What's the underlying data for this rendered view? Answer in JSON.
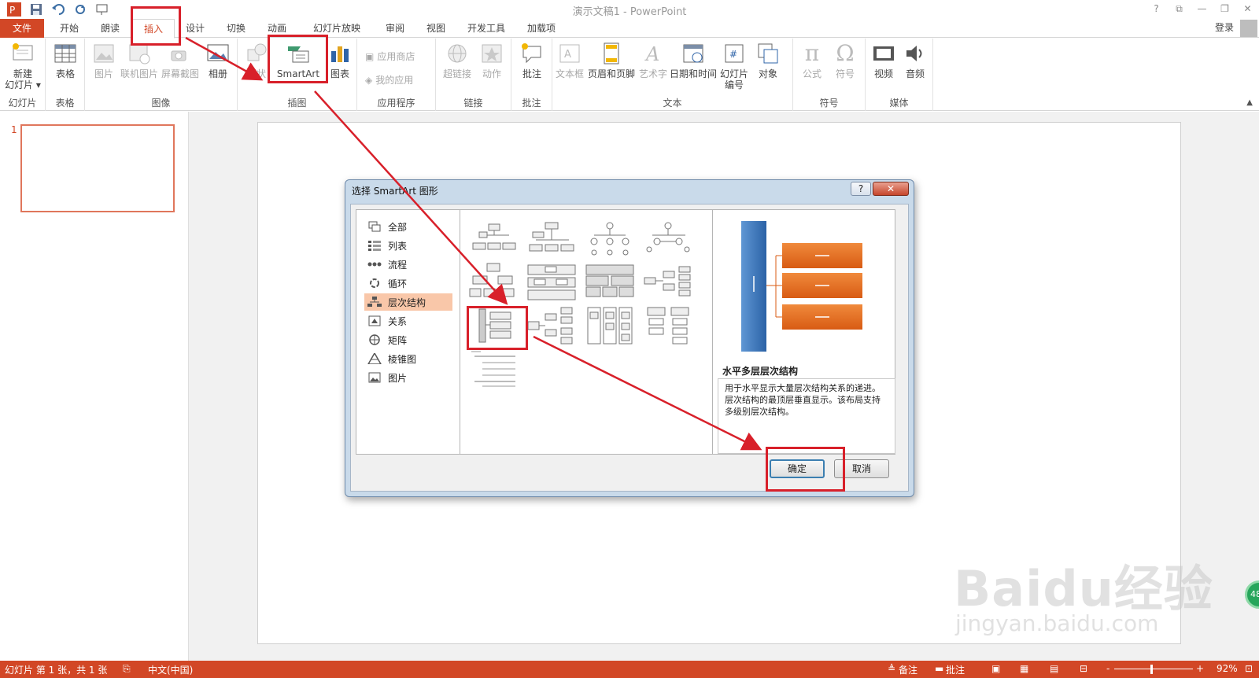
{
  "app": {
    "title": "演示文稿1 - PowerPoint",
    "login": "登录"
  },
  "window": {
    "help": "?",
    "ribbon_display": "⧉",
    "minimize": "—",
    "restore": "❐",
    "close": "✕"
  },
  "tabs": [
    "文件",
    "开始",
    "朗读",
    "插入",
    "设计",
    "切换",
    "动画",
    "幻灯片放映",
    "审阅",
    "视图",
    "开发工具",
    "加载项"
  ],
  "ribbon": {
    "groups": [
      "幻灯片",
      "表格",
      "图像",
      "插图",
      "应用程序",
      "链接",
      "批注",
      "文本",
      "符号",
      "媒体"
    ],
    "new_slide_l1": "新建",
    "new_slide_l2": "幻灯片 ▾",
    "table": "表格",
    "picture": "图片",
    "online_picture": "联机图片",
    "screenshot": "屏幕截图",
    "album": "相册",
    "shapes": "形状",
    "smartart": "SmartArt",
    "chart": "图表",
    "store": "应用商店",
    "my_apps": "我的应用",
    "hyperlink": "超链接",
    "action": "动作",
    "comment": "批注",
    "textbox": "文本框",
    "header_footer": "页眉和页脚",
    "wordart": "艺术字",
    "datetime": "日期和时间",
    "slide_number_l1": "幻灯片",
    "slide_number_l2": "编号",
    "object": "对象",
    "equation": "公式",
    "symbol": "符号",
    "video": "视频",
    "audio": "音频"
  },
  "thumbnails": {
    "number": "1"
  },
  "dialog": {
    "title": "选择 SmartArt 图形",
    "help": "?",
    "close": "✕",
    "categories": [
      {
        "label": "全部",
        "icon": "all-icon"
      },
      {
        "label": "列表",
        "icon": "list-icon"
      },
      {
        "label": "流程",
        "icon": "process-icon"
      },
      {
        "label": "循环",
        "icon": "cycle-icon"
      },
      {
        "label": "层次结构",
        "icon": "hierarchy-icon",
        "selected": true
      },
      {
        "label": "关系",
        "icon": "relationship-icon"
      },
      {
        "label": "矩阵",
        "icon": "matrix-icon"
      },
      {
        "label": "棱锥图",
        "icon": "pyramid-icon"
      },
      {
        "label": "图片",
        "icon": "picture-icon"
      }
    ],
    "preview_name": "水平多层层次结构",
    "preview_desc": "用于水平显示大量层次结构关系的递进。层次结构的最顶层垂直显示。该布局支持多级别层次结构。",
    "ok": "确定",
    "cancel": "取消"
  },
  "watermark": {
    "brand": "Baidu经验",
    "url": "jingyan.baidu.com",
    "badge": "48"
  },
  "statusbar": {
    "slide_info": "幻灯片 第 1 张，共 1 张",
    "language": "中文(中国)",
    "notes": "备注",
    "comments": "批注",
    "zoom_minus": "-",
    "zoom_plus": "+",
    "zoom": "92%"
  },
  "colors": {
    "accent": "#d24726",
    "highlight": "#d8202a",
    "preview_blue": "#3d78b8",
    "preview_orange": "#e2661f"
  }
}
